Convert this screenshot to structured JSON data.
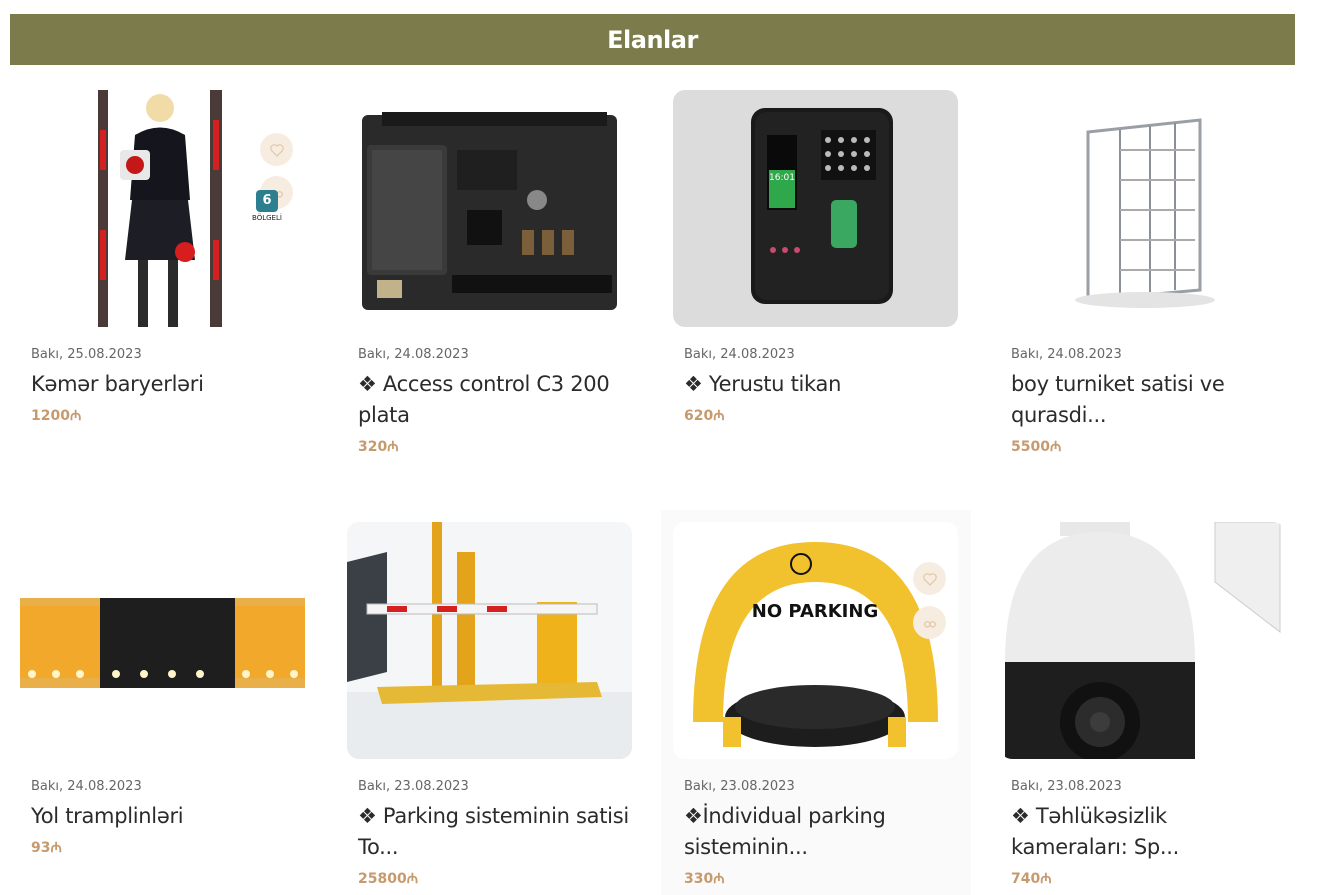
{
  "header": {
    "title": "Elanlar"
  },
  "listings": [
    {
      "date": "Bakı, 25.08.2023",
      "title": "Kəmər baryerləri",
      "price": "1200₼",
      "badge": {
        "number": "6",
        "label": "BÖLGELİ"
      }
    },
    {
      "date": "Bakı, 24.08.2023",
      "title": "❖ Access control C3 200 plata",
      "price": "320₼"
    },
    {
      "date": "Bakı, 24.08.2023",
      "title": "❖ Yerustu tikan",
      "price": "620₼",
      "device_time": "16:01"
    },
    {
      "date": "Bakı, 24.08.2023",
      "title": "boy turniket satisi ve qurasdi...",
      "price": "5500₼"
    },
    {
      "date": "Bakı, 24.08.2023",
      "title": "Yol tramplinləri",
      "price": "93₼"
    },
    {
      "date": "Bakı, 23.08.2023",
      "title": "❖ Parking sisteminin satisi To...",
      "price": "25800₼"
    },
    {
      "date": "Bakı, 23.08.2023",
      "title": "❖İndividual parking sisteminin...",
      "price": "330₼",
      "sign_text": "NO PARKING"
    },
    {
      "date": "Bakı, 23.08.2023",
      "title": "❖ Təhlükəsizlik kameraları: Sp...",
      "price": "740₼"
    }
  ],
  "colors": {
    "header_bg": "#7b7b4c",
    "price": "#c79a6e",
    "accent_yellow": "#f2c12e"
  },
  "icons": [
    "heart-icon",
    "compare-icon"
  ]
}
